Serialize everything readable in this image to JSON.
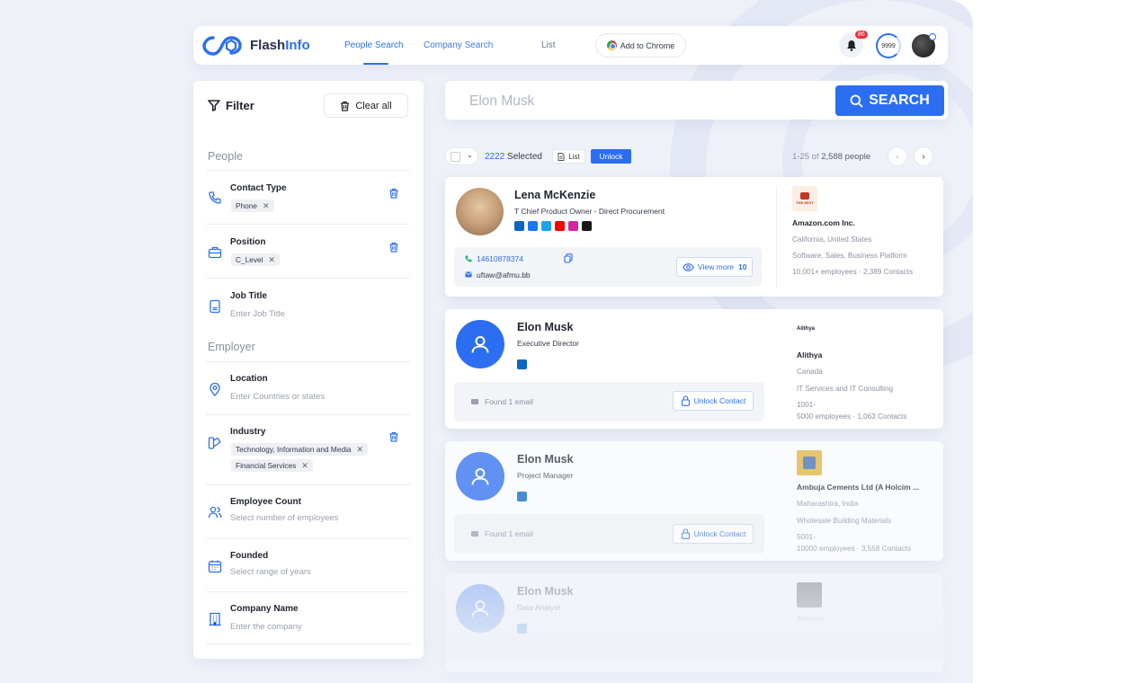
{
  "app": {
    "brand_main": "Flash",
    "brand_accent": "Info"
  },
  "nav": {
    "people_search": "People Search",
    "company_search": "Company Search",
    "list": "List",
    "add_chrome": "Add to Chrome",
    "notif_count": "86",
    "credits": "9999"
  },
  "filter": {
    "title": "Filter",
    "clear_all": "Clear all",
    "people_section": "People",
    "employer_section": "Employer",
    "items": [
      {
        "label": "Contact Type",
        "chips": [
          "Phone"
        ]
      },
      {
        "label": "Position",
        "chips": [
          "C_Level"
        ]
      },
      {
        "label": "Job Title",
        "placeholder": "Enter Job Title"
      },
      {
        "label": "Location",
        "placeholder": "Enter Countries or states"
      },
      {
        "label": "Industry",
        "chips": [
          "Technology, Information and Media",
          "Financial Services"
        ]
      },
      {
        "label": "Employee Count",
        "placeholder": "Select number of employees"
      },
      {
        "label": "Founded",
        "placeholder": "Select range of years"
      },
      {
        "label": "Company Name",
        "placeholder": "Enter the company"
      }
    ]
  },
  "search": {
    "value": "Elon Musk",
    "button": "SEARCH"
  },
  "toolbar": {
    "selected_num": "2222",
    "selected_label": "Selected",
    "list_btn": "List",
    "unlock_btn": "Unlock",
    "range": "1-25",
    "of": "of",
    "total": "2,588",
    "unit": "people"
  },
  "results": [
    {
      "name": "Lena McKenzie",
      "role": "T Chief Product Owner - Direct Procurement",
      "phone": "14610878374",
      "email": "uftaw@afmu.bb",
      "view_more": "View more",
      "view_more_count": "10",
      "company": {
        "name": "Amazon.com Inc.",
        "logo_text": "THE NEXT",
        "location": "California, United States",
        "industry": "Software, Sales, Business Platform",
        "stats": "10,001+ employees · 2,389 Contacts"
      }
    },
    {
      "name": "Elon Musk",
      "role": "Executive Director",
      "found": "Found 1 email",
      "unlock": "Unlock Contact",
      "company": {
        "name": "Alithya",
        "logo_text": "Alithya",
        "location": "Canada",
        "industry": "IT Services and IT Consulting",
        "stats_1": "1001-",
        "stats_2": "5000 employees · 1,063 Contacts"
      }
    },
    {
      "name": "Elon Musk",
      "role": "Project Manager",
      "found": "Found 1 email",
      "unlock": "Unlock Contact",
      "company": {
        "name": "Ambuja Cements Ltd (A Holcim ...",
        "location": "Maharashtra, India",
        "industry": "Wholesale Building Materials",
        "stats_1": "5001-",
        "stats_2": "10000 employees · 3,558 Contacts"
      }
    },
    {
      "name": "Elon Musk",
      "role": "Data Analyst",
      "company": {
        "name": "Amazon"
      }
    }
  ],
  "colors": {
    "accent": "#2c6ef2",
    "background": "#eef1f8"
  }
}
